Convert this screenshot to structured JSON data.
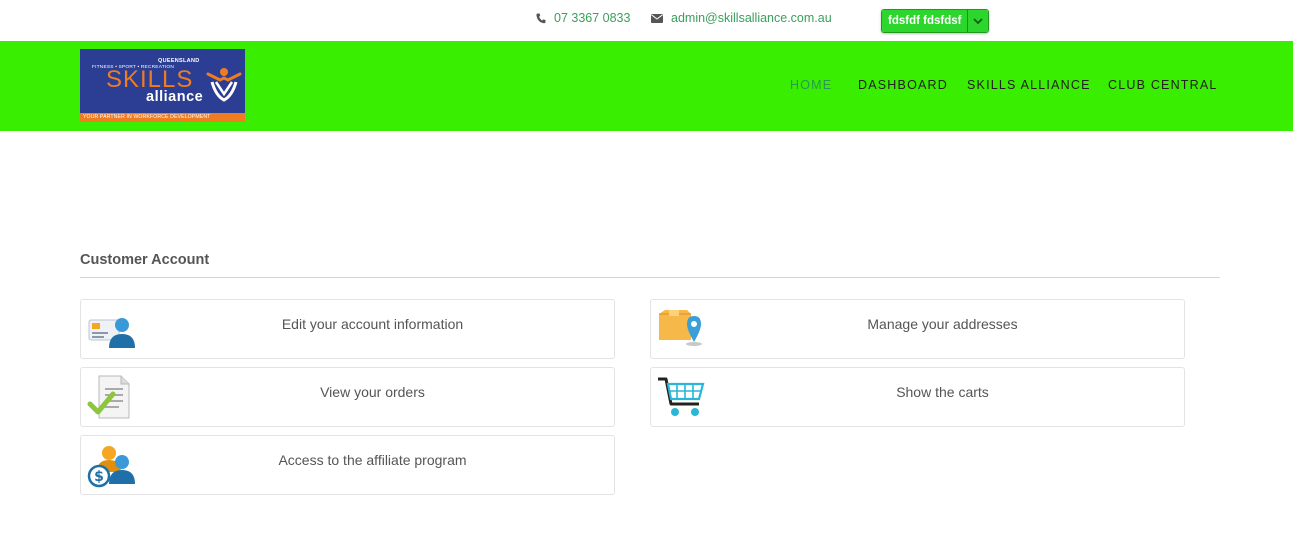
{
  "topbar": {
    "phone": "07 3367 0833",
    "email": "admin@skillsalliance.com.au",
    "user_name": "fdsfdf fdsfdsf",
    "phone_icon": "phone-icon",
    "email_icon": "envelope-icon",
    "dropdown_icon": "chevron-down-icon"
  },
  "logo": {
    "state": "QUEENSLAND",
    "tagline_top": "FITNESS • SPORT • RECREATION",
    "word1": "SKILLS",
    "word2": "alliance",
    "strip": "YOUR PARTNER IN WORKFORCE DEVELOPMENT"
  },
  "nav": {
    "items": [
      {
        "label": "HOME",
        "active": true
      },
      {
        "label": "DASHBOARD",
        "active": false
      },
      {
        "label": "SKILLS ALLIANCE",
        "active": false
      },
      {
        "label": "CLUB CENTRAL",
        "active": false
      }
    ]
  },
  "account": {
    "title": "Customer Account",
    "cards": [
      {
        "label": "Edit your account information",
        "icon": "user-card-icon"
      },
      {
        "label": "Manage your addresses",
        "icon": "address-pin-icon"
      },
      {
        "label": "View your orders",
        "icon": "orders-check-icon"
      },
      {
        "label": "Show the carts",
        "icon": "cart-icon"
      },
      {
        "label": "Access to the affiliate program",
        "icon": "affiliate-dollar-icon"
      }
    ]
  },
  "colors": {
    "header_bg": "#39ee00",
    "accent_green": "#3aa05a",
    "user_button": "#2dd62d",
    "logo_blue": "#2b3e93",
    "logo_orange": "#f07c21"
  }
}
